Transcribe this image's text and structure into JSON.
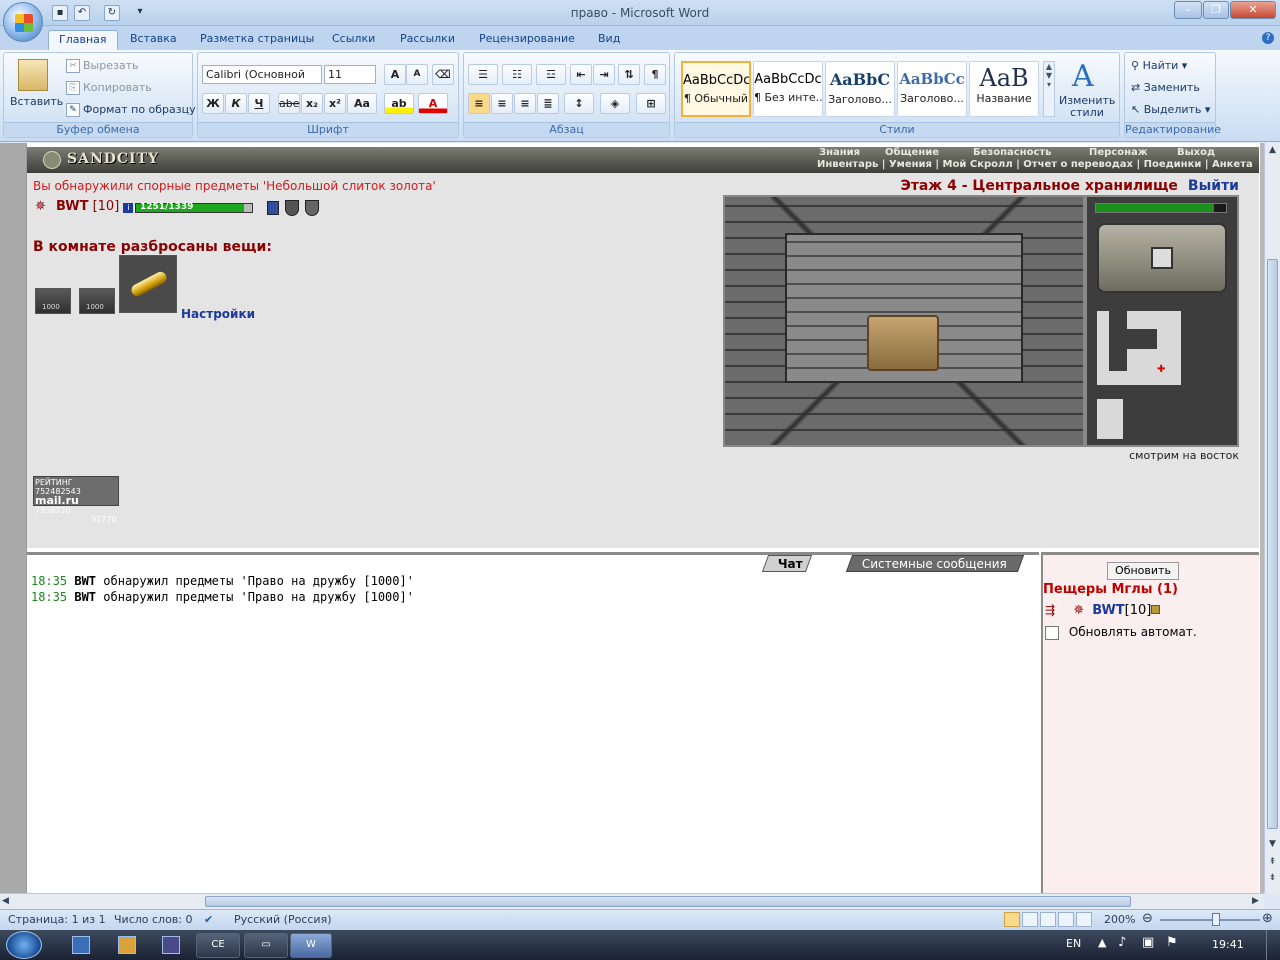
{
  "window": {
    "title": "право - Microsoft Word"
  },
  "ribbon": {
    "tabs": [
      "Главная",
      "Вставка",
      "Разметка страницы",
      "Ссылки",
      "Рассылки",
      "Рецензирование",
      "Вид"
    ],
    "clipboard": {
      "paste": "Вставить",
      "cut": "Вырезать",
      "copy": "Копировать",
      "format_painter": "Формат по образцу",
      "label": "Буфер обмена"
    },
    "font": {
      "name": "Calibri (Основной те",
      "size": "11",
      "label": "Шрифт",
      "bold": "Ж",
      "italic": "К",
      "underline": "Ч",
      "strike": "abe",
      "sub": "x₂",
      "sup": "x²",
      "case": "Aa",
      "grow": "A",
      "shrink": "A"
    },
    "paragraph": {
      "label": "Абзац"
    },
    "styles": {
      "items": [
        {
          "sample": "AaBbCcDc",
          "name": "¶ Обычный"
        },
        {
          "sample": "AaBbCcDc",
          "name": "¶ Без инте..."
        },
        {
          "sample": "AaBbC",
          "name": "Заголово..."
        },
        {
          "sample": "AaBbCc",
          "name": "Заголово..."
        },
        {
          "sample": "AaB",
          "name": "Название"
        }
      ],
      "change": "Изменить стили",
      "label": "Стили"
    },
    "editing": {
      "find": "Найти",
      "replace": "Заменить",
      "select": "Выделить",
      "label": "Редактирование"
    }
  },
  "game": {
    "logo": "SANDCITY",
    "nav_top": [
      "Знания",
      "Общение",
      "Безопасность",
      "Персонаж",
      "Выход"
    ],
    "nav_bottom": "Инвентарь | Умения | Мой Скролл | Отчет о переводах | Поединки | Анкета",
    "found_message": "Вы обнаружили спорные предметы 'Небольшой слиток золота'",
    "floor": "Этаж 4 - Центральное хранилище",
    "exit": "Выйти",
    "char": {
      "name": "BWT",
      "level": "[10]",
      "hp": "1251/1339",
      "hp_fraction": 0.934
    },
    "items_title": "В комнате разбросаны вещи:",
    "scroll_label": "1000",
    "settings": "Настройки",
    "view_caption": "смотрим на восток",
    "rating": {
      "line1": "РЕЙТИНГ",
      "n1": "752482543",
      "brand": "mail.ru",
      "n2": "7938720",
      "n3": "31770"
    }
  },
  "chat": {
    "tabs": [
      "Чат",
      "Системные сообщения"
    ],
    "messages": [
      {
        "time": "18:35",
        "user": "BWT",
        "text": "обнаружил предметы 'Право на дружбу [1000]'"
      },
      {
        "time": "18:35",
        "user": "BWT",
        "text": "обнаружил предметы 'Право на дружбу [1000]'"
      }
    ]
  },
  "room": {
    "refresh": "Обновить",
    "name": "Пещеры Мглы (1)",
    "user": "BWT",
    "level": "[10]",
    "auto": "Обновлять автомат."
  },
  "status": {
    "page": "Страница: 1 из 1",
    "words": "Число слов: 0",
    "lang": "Русский (Россия)",
    "zoom": "200%"
  },
  "taskbar": {
    "lang": "EN",
    "time": "19:41"
  }
}
